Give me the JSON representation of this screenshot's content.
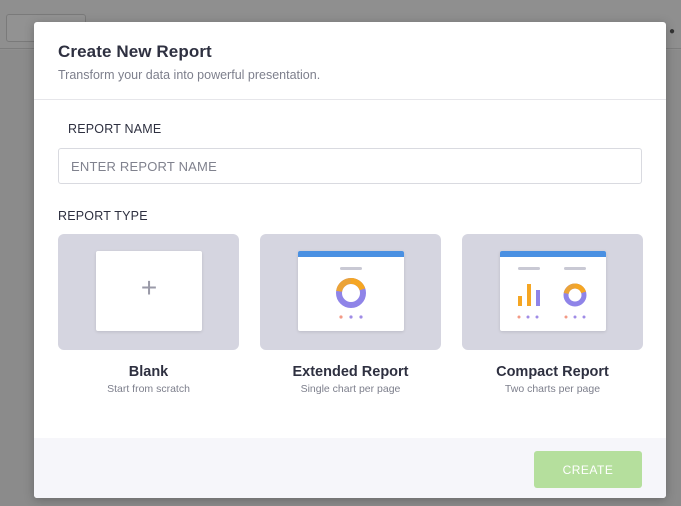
{
  "modal": {
    "title": "Create New Report",
    "subtitle": "Transform your data into powerful presentation."
  },
  "form": {
    "name_label": "REPORT NAME",
    "name_placeholder": "ENTER REPORT NAME",
    "name_value": "",
    "type_label": "REPORT TYPE"
  },
  "report_types": [
    {
      "title": "Blank",
      "description": "Start from scratch",
      "icon": "plus-icon"
    },
    {
      "title": "Extended Report",
      "description": "Single chart per page",
      "icon": "donut-chart-icon"
    },
    {
      "title": "Compact Report",
      "description": "Two charts per page",
      "icon": "bar-and-donut-chart-icon"
    }
  ],
  "footer": {
    "create_label": "CREATE",
    "create_enabled": false
  },
  "colors": {
    "accent_blue": "#4a90e2",
    "card_bg": "#d5d5e0",
    "create_button": "#b5df9d",
    "donut_orange": "#f5a623",
    "donut_purple": "#8f84e8",
    "bar_orange": "#f5a623",
    "bar_purple": "#8f84e8",
    "dot_orange": "#f39a86",
    "dot_purple": "#a08ce6"
  }
}
